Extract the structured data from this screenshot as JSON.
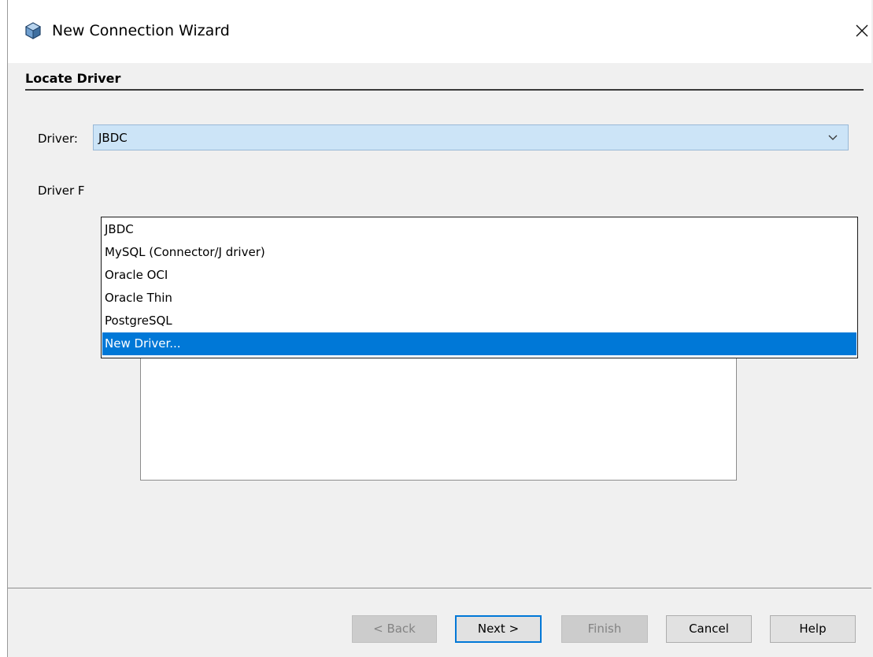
{
  "window": {
    "title": "New Connection Wizard",
    "icon": "cube-icon",
    "close_icon": "close-icon"
  },
  "step": {
    "title": "Locate Driver"
  },
  "form": {
    "driver_label": "Driver:",
    "driver_value": "JBDC",
    "driver_file_label_visible": "Driver F"
  },
  "dropdown": {
    "options": [
      {
        "label": "JBDC",
        "selected": false
      },
      {
        "label": "MySQL (Connector/J driver)",
        "selected": false
      },
      {
        "label": "Oracle OCI",
        "selected": false
      },
      {
        "label": "Oracle Thin",
        "selected": false
      },
      {
        "label": "PostgreSQL",
        "selected": false
      },
      {
        "label": "New Driver...",
        "selected": true
      }
    ]
  },
  "buttons": {
    "back": "< Back",
    "next": "Next >",
    "finish": "Finish",
    "cancel": "Cancel",
    "help": "Help"
  },
  "colors": {
    "selection": "#0078d7",
    "combo_background": "#cce4f7",
    "panel_background": "#f0f0f0"
  }
}
